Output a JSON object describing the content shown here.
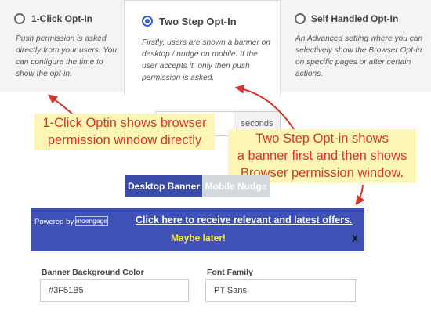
{
  "options": [
    {
      "title": "1-Click Opt-In",
      "desc": "Push permission is asked directly from your users. You can configure the time to show the opt-in.",
      "selected": false
    },
    {
      "title": "Two Step Opt-In",
      "desc": "Firstly, users are shown a banner on desktop / nudge on mobile. If the user accepts it, only then push permission is asked.",
      "selected": true
    },
    {
      "title": "Self Handled Opt-In",
      "desc": "An Advanced setting where you can selectively show the Browser Opt-in on specific pages or after certain actions.",
      "selected": false
    }
  ],
  "delay": {
    "unit": "seconds",
    "value": ""
  },
  "annotations": {
    "one_click_lines": [
      "1-Click Optin shows browser",
      "permission window directly"
    ],
    "two_step_lines": [
      "Two Step Opt-in shows",
      "a banner first and then shows",
      "Browser permission window."
    ]
  },
  "tabs": {
    "desktop": "Desktop Banner",
    "mobile": "Mobile Nudge"
  },
  "banner": {
    "powered_by": "Powered by",
    "logo_text": "moengage",
    "link_text": "Click here to receive relevant and latest offers.",
    "later_text": "Maybe later!",
    "close_text": "X",
    "bg_color": "#3F51B5"
  },
  "fields": {
    "bg_color_label": "Banner Background Color",
    "bg_color_value": "#3F51B5",
    "font_label": "Font Family",
    "font_value": "PT Sans"
  }
}
